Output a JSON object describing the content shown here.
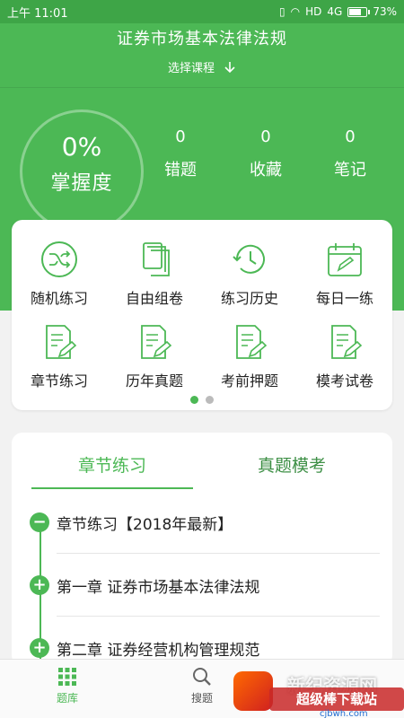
{
  "status_bar": {
    "time": "上午 11:01",
    "network": "HD",
    "signal": "4G",
    "battery": "73%",
    "battery_level": 0.73
  },
  "header": {
    "title": "证券市场基本法律法规",
    "course_select_label": "选择课程"
  },
  "stats": {
    "mastery_percent": "0%",
    "mastery_label": "掌握度",
    "items": [
      {
        "value": "0",
        "label": "错题"
      },
      {
        "value": "0",
        "label": "收藏"
      },
      {
        "value": "0",
        "label": "笔记"
      }
    ]
  },
  "features": {
    "items": [
      {
        "label": "随机练习",
        "icon": "shuffle-icon"
      },
      {
        "label": "自由组卷",
        "icon": "stacked-papers-icon"
      },
      {
        "label": "练习历史",
        "icon": "history-clock-icon"
      },
      {
        "label": "每日一练",
        "icon": "calendar-edit-icon"
      },
      {
        "label": "章节练习",
        "icon": "document-edit-icon"
      },
      {
        "label": "历年真题",
        "icon": "document-edit-icon"
      },
      {
        "label": "考前押题",
        "icon": "document-edit-icon"
      },
      {
        "label": "模考试卷",
        "icon": "document-edit-icon"
      }
    ],
    "page_count": 2,
    "active_page": 1
  },
  "chapters": {
    "tabs": [
      {
        "label": "章节练习",
        "active": true
      },
      {
        "label": "真题模考",
        "active": false
      }
    ],
    "items": [
      {
        "label": "章节练习【2018年最新】",
        "expanded": true
      },
      {
        "label": "第一章 证券市场基本法律法规",
        "expanded": false
      },
      {
        "label": "第二章 证券经营机构管理规范",
        "expanded": false
      }
    ]
  },
  "bottom_nav": {
    "items": [
      {
        "label": "题库",
        "icon": "grid-icon",
        "active": true
      },
      {
        "label": "搜题",
        "icon": "search-icon",
        "active": false
      }
    ]
  },
  "watermark": {
    "text": "新纪资源网",
    "badge_text": "超级棒下载站",
    "url": "cjbwh.com"
  },
  "colors": {
    "brand_green": "#4cb855",
    "status_green": "#3ea547",
    "text_dark": "#222222",
    "dot_inactive": "#bbbbbb"
  }
}
